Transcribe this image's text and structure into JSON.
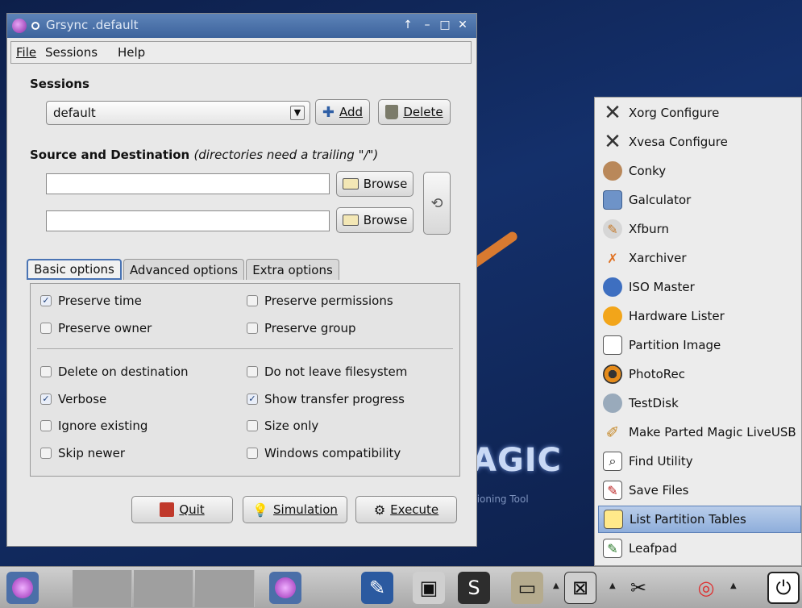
{
  "window": {
    "title": "Grsync .default",
    "titlebar_buttons": {
      "up": "↑",
      "min": "–",
      "max": "□",
      "close": "✕"
    }
  },
  "menubar": {
    "file": "File",
    "sessions": "Sessions",
    "help": "Help"
  },
  "sessions": {
    "title": "Sessions",
    "selected": "default",
    "add_label": "Add",
    "delete_label": "Delete"
  },
  "source_dest": {
    "title": "Source and Destination",
    "note": "(directories need a trailing \"/\")",
    "source_value": "",
    "dest_value": "",
    "browse_label": "Browse"
  },
  "tabs": [
    {
      "label": "Basic options"
    },
    {
      "label": "Advanced options"
    },
    {
      "label": "Extra options"
    }
  ],
  "options": {
    "preserve_time": {
      "label": "Preserve time",
      "checked": true
    },
    "preserve_permissions": {
      "label": "Preserve permissions",
      "checked": false
    },
    "preserve_owner": {
      "label": "Preserve owner",
      "checked": false
    },
    "preserve_group": {
      "label": "Preserve group",
      "checked": false
    },
    "delete_on_destination": {
      "label": "Delete on destination",
      "checked": false
    },
    "do_not_leave_fs": {
      "label": "Do not leave filesystem",
      "checked": false
    },
    "verbose": {
      "label": "Verbose",
      "checked": true
    },
    "show_progress": {
      "label": "Show transfer progress",
      "checked": true
    },
    "ignore_existing": {
      "label": "Ignore existing",
      "checked": false
    },
    "size_only": {
      "label": "Size only",
      "checked": false
    },
    "skip_newer": {
      "label": "Skip newer",
      "checked": false
    },
    "windows_compat": {
      "label": "Windows compatibility",
      "checked": false
    }
  },
  "actions": {
    "quit": "Quit",
    "simulation": "Simulation",
    "execute": "Execute"
  },
  "desktop": {
    "logo_text": "AGIC",
    "tagline": "tioning Tool"
  },
  "launcher": {
    "items": [
      {
        "label": "Xorg Configure",
        "icon": "x-icon"
      },
      {
        "label": "Xvesa Configure",
        "icon": "x-icon"
      },
      {
        "label": "Conky",
        "icon": "conky-icon"
      },
      {
        "label": "Galculator",
        "icon": "calculator-icon"
      },
      {
        "label": "Xfburn",
        "icon": "disc-burn-icon"
      },
      {
        "label": "Xarchiver",
        "icon": "archive-icon"
      },
      {
        "label": "ISO Master",
        "icon": "iso-disc-icon"
      },
      {
        "label": "Hardware Lister",
        "icon": "hardware-icon"
      },
      {
        "label": "Partition Image",
        "icon": "partition-image-icon"
      },
      {
        "label": "PhotoRec",
        "icon": "photorec-icon"
      },
      {
        "label": "TestDisk",
        "icon": "testdisk-icon"
      },
      {
        "label": "Make Parted Magic LiveUSB",
        "icon": "usb-icon"
      },
      {
        "label": "Find Utility",
        "icon": "find-icon"
      },
      {
        "label": "Save Files",
        "icon": "save-files-icon"
      },
      {
        "label": "List Partition Tables",
        "icon": "partition-table-icon"
      },
      {
        "label": "Leafpad",
        "icon": "leafpad-icon"
      }
    ],
    "selected_index": 14
  }
}
